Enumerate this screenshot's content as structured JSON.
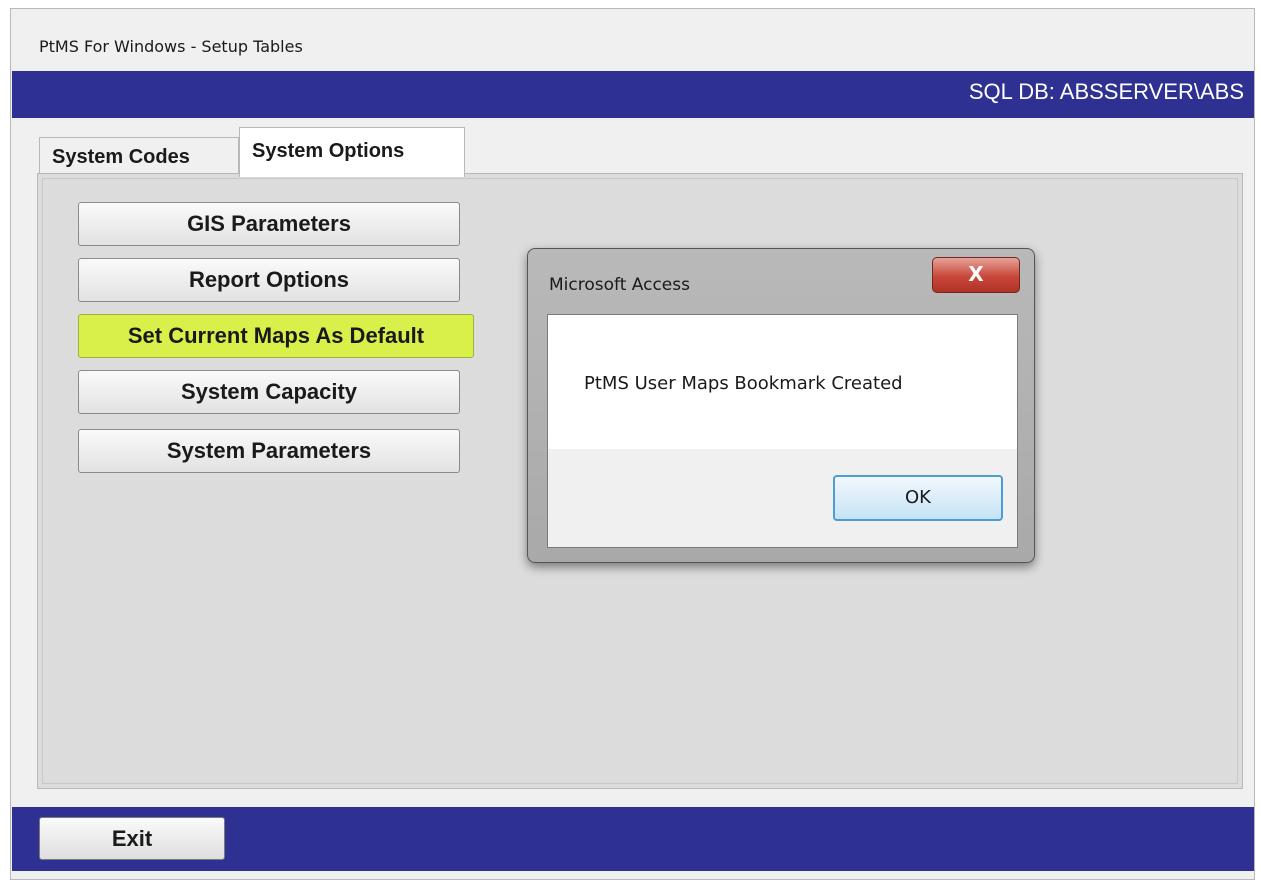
{
  "window": {
    "title": "PtMS For Windows - Setup Tables",
    "sql_db_label": "SQL DB: ABSSERVER\\ABS"
  },
  "tabs": [
    {
      "label": "System Codes",
      "active": false
    },
    {
      "label": "System Options",
      "active": true
    }
  ],
  "options_buttons": [
    {
      "label": "GIS Parameters",
      "highlighted": false
    },
    {
      "label": "Report Options",
      "highlighted": false
    },
    {
      "label": "Set Current Maps As Default",
      "highlighted": true
    },
    {
      "label": "System Capacity",
      "highlighted": false
    },
    {
      "label": "System Parameters",
      "highlighted": false
    }
  ],
  "footer": {
    "exit_label": "Exit"
  },
  "dialog": {
    "title": "Microsoft Access",
    "close_glyph": "X",
    "message": "PtMS User Maps Bookmark Created",
    "ok_label": "OK"
  },
  "colors": {
    "header_band": "#2e3192",
    "highlight": "#d9f04a",
    "ok_border": "#4a9ed3",
    "close_button": "#c8473a"
  }
}
